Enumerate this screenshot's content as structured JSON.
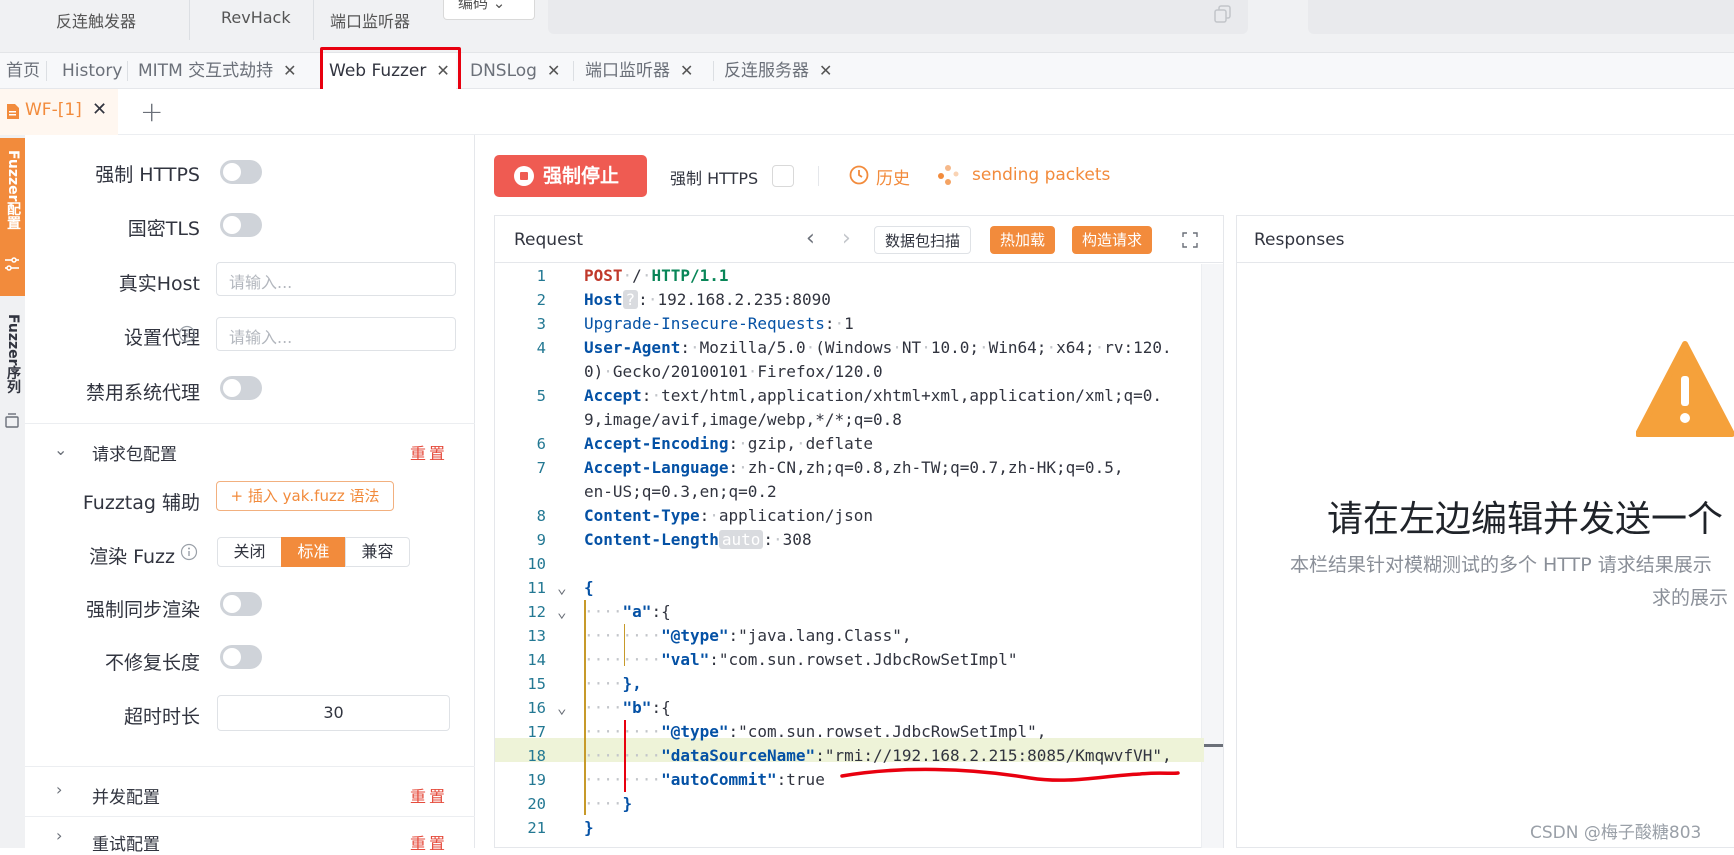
{
  "topbar": {
    "items": [
      "反连触发器",
      "RevHack",
      "端口监听器"
    ],
    "encode_select": "编码"
  },
  "tabs": [
    {
      "label": "首页"
    },
    {
      "label": "History"
    },
    {
      "label": "MITM 交互式劫持",
      "close": "✕"
    },
    {
      "label": "Web Fuzzer",
      "close": "✕"
    },
    {
      "label": "DNSLog",
      "close": "✕"
    },
    {
      "label": "端口监听器",
      "close": "✕"
    },
    {
      "label": "反连服务器",
      "close": "✕"
    }
  ],
  "subtab": {
    "label": "WF-[1]",
    "close": "✕",
    "add": "+"
  },
  "left_strip": {
    "config_tab": "Fuzzer配置",
    "sequence_tab": "Fuzzer序列"
  },
  "config": {
    "force_https": "强制 HTTPS",
    "gm_tls": "国密TLS",
    "real_host": "真实Host",
    "real_host_placeholder": "请输入...",
    "proxy": "设置代理",
    "proxy_placeholder": "请输入...",
    "disable_sys_proxy": "禁用系统代理",
    "request_section": "请求包配置",
    "reset": "重置",
    "fuzztag": "Fuzztag 辅助",
    "insert_btn": "+ 插入 yak.fuzz 语法",
    "render_fuzz": "渲染 Fuzz",
    "render_options": [
      "关闭",
      "标准",
      "兼容"
    ],
    "render_selected": "标准",
    "force_sync": "强制同步渲染",
    "no_fix_length": "不修复长度",
    "timeout": "超时时长",
    "timeout_value": "30",
    "concurrency_section": "并发配置",
    "retry_section": "重试配置"
  },
  "toolbar": {
    "stop": "强制停止",
    "force_https": "强制 HTTPS",
    "history": "历史",
    "sending": "sending packets"
  },
  "request": {
    "title": "Request",
    "scan": "数据包扫描",
    "hot_load": "热加载",
    "construct": "构造请求",
    "lines": [
      "1",
      "2",
      "3",
      "4",
      "",
      "5",
      "",
      "6",
      "7",
      "",
      "8",
      "9",
      "10",
      "11",
      "12",
      "13",
      "14",
      "15",
      "16",
      "17",
      "18",
      "19",
      "20",
      "21"
    ]
  },
  "response": {
    "title": "Responses",
    "heading": "请在左边编辑并发送一个",
    "desc1": "本栏结果针对模糊测试的多个 HTTP 请求结果展示",
    "desc2": "求的展示"
  },
  "watermark": "CSDN @梅子酸糖803",
  "colors": {
    "accent": "#f28b3c",
    "danger": "#ef5b52",
    "warning": "#f5a13b"
  }
}
